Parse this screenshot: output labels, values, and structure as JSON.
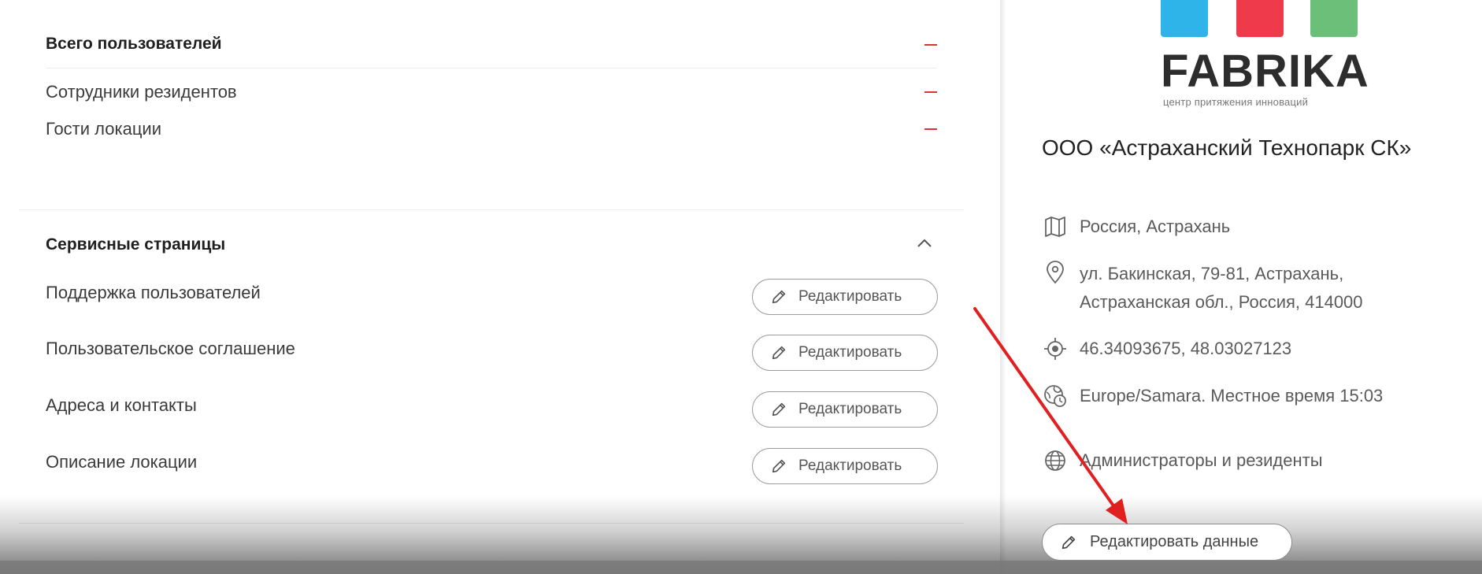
{
  "stats": {
    "total_users_label": "Всего пользователей",
    "resident_staff_label": "Сотрудники резидентов",
    "location_guests_label": "Гости локации"
  },
  "service_pages": {
    "title": "Сервисные страницы",
    "edit_label": "Редактировать",
    "items": [
      {
        "label": "Поддержка пользователей"
      },
      {
        "label": "Пользовательское соглашение"
      },
      {
        "label": "Адреса и контакты"
      },
      {
        "label": "Описание локации"
      }
    ]
  },
  "location": {
    "logo_text": "FABRIKA",
    "logo_subtitle": "центр притяжения инноваций",
    "logo_colors": [
      "#2fb4e9",
      "#ee3a4a",
      "#6cbf78"
    ],
    "org_name": "ООО «Астраханский Технопарк СК»",
    "region": "Россия, Астрахань",
    "address_line1": "ул. Бакинская, 79-81, Астрахань,",
    "address_line2": "Астраханская обл., Россия, 414000",
    "coordinates": "46.34093675, 48.03027123",
    "timezone": "Europe/Samara. Местное время 15:03",
    "access": "Администраторы и резиденты",
    "edit_data_label": "Редактировать данные"
  },
  "colors": {
    "accent_red": "#e0303a",
    "annotation_arrow": "#e02020"
  },
  "icons": [
    "pencil-icon",
    "map-icon",
    "location-pin-icon",
    "target-icon",
    "globe-clock-icon",
    "globe-icon",
    "chevron-up-icon"
  ]
}
